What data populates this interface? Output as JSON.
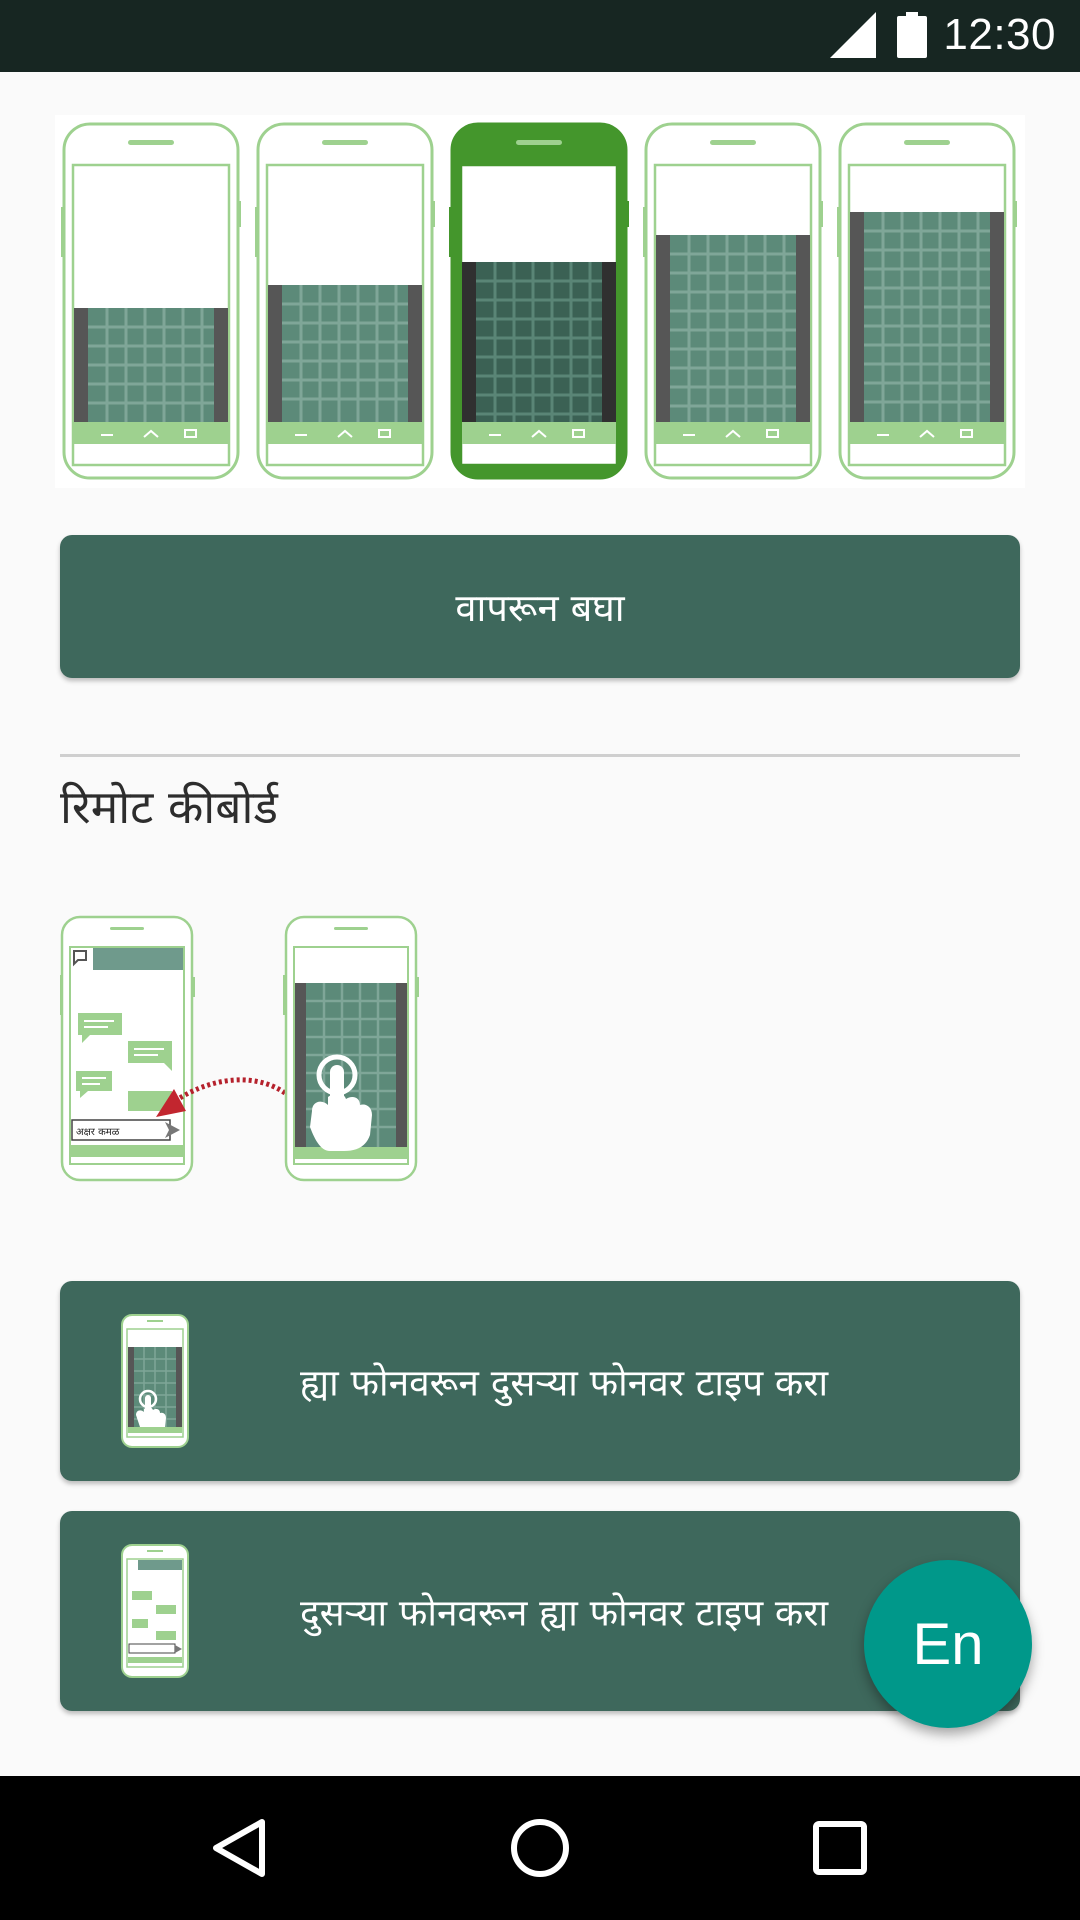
{
  "status_bar": {
    "time": "12:30",
    "icons": [
      "signal-icon",
      "battery-icon"
    ]
  },
  "keyboard_height_options": {
    "count": 5,
    "selected_index": 2,
    "colors": {
      "selected": "#44962c",
      "outline": "#9ed18f",
      "grid": "#5c8a79"
    }
  },
  "try_button": {
    "label": "वापरून बघा"
  },
  "remote_section": {
    "title": "रिमोट कीबोर्ड",
    "illustration_input_text": "अक्षर कमळ"
  },
  "remote_buttons": [
    {
      "label": "ह्या फोनवरून दुसऱ्या फोनवर टाइप करा",
      "icon": "keyboard-phone-icon"
    },
    {
      "label": "दुसऱ्या फोनवरून ह्या फोनवर टाइप करा",
      "icon": "chat-phone-icon"
    }
  ],
  "fab": {
    "label": "En"
  },
  "nav_bar": {
    "buttons": [
      "back-icon",
      "home-icon",
      "recents-icon"
    ]
  },
  "colors": {
    "status_bar": "#172622",
    "button": "#3e685c",
    "fab": "#00988a",
    "background": "#fafafa"
  }
}
